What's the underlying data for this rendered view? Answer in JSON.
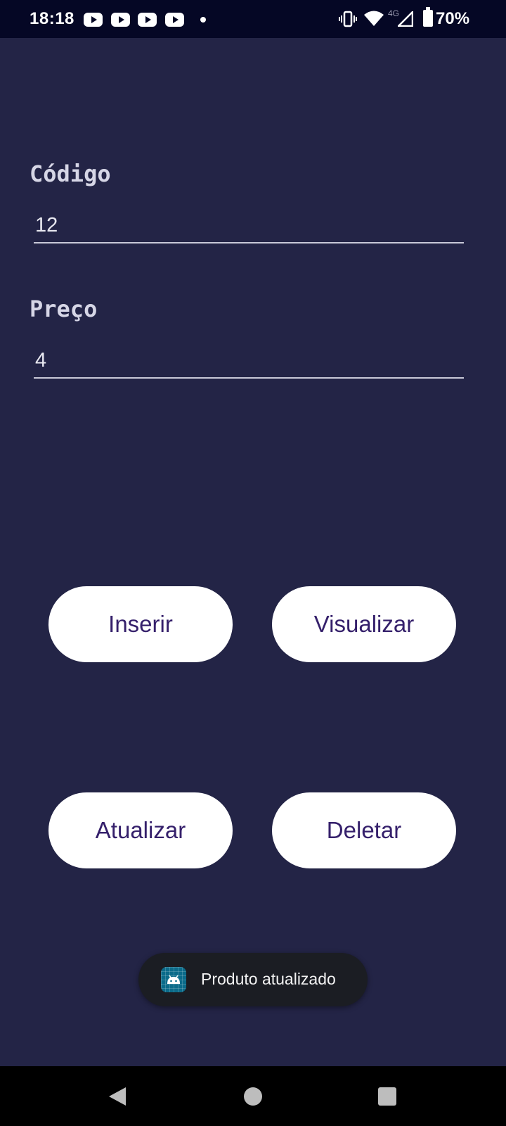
{
  "status_bar": {
    "time": "18:18",
    "network": "4G",
    "battery": "70%",
    "icons": [
      "youtube-icon",
      "youtube-icon",
      "youtube-icon",
      "youtube-icon",
      "notification-dot",
      "vibrate-icon",
      "wifi-icon",
      "signal-icon",
      "battery-icon"
    ]
  },
  "form": {
    "codigo_label": "Código",
    "codigo_value": "12",
    "preco_label": "Preço",
    "preco_value": "4"
  },
  "buttons": {
    "inserir": "Inserir",
    "visualizar": "Visualizar",
    "atualizar": "Atualizar",
    "deletar": "Deletar"
  },
  "toast": {
    "icon": "android-app-icon",
    "message": "Produto atualizado"
  },
  "nav_bar": {
    "icons": [
      "back-icon",
      "home-icon",
      "recents-icon"
    ]
  },
  "colors": {
    "background": "#232446",
    "status_bar": "#050725",
    "button_bg": "#ffffff",
    "button_text": "#35206b",
    "toast_bg": "#1b1d23"
  }
}
